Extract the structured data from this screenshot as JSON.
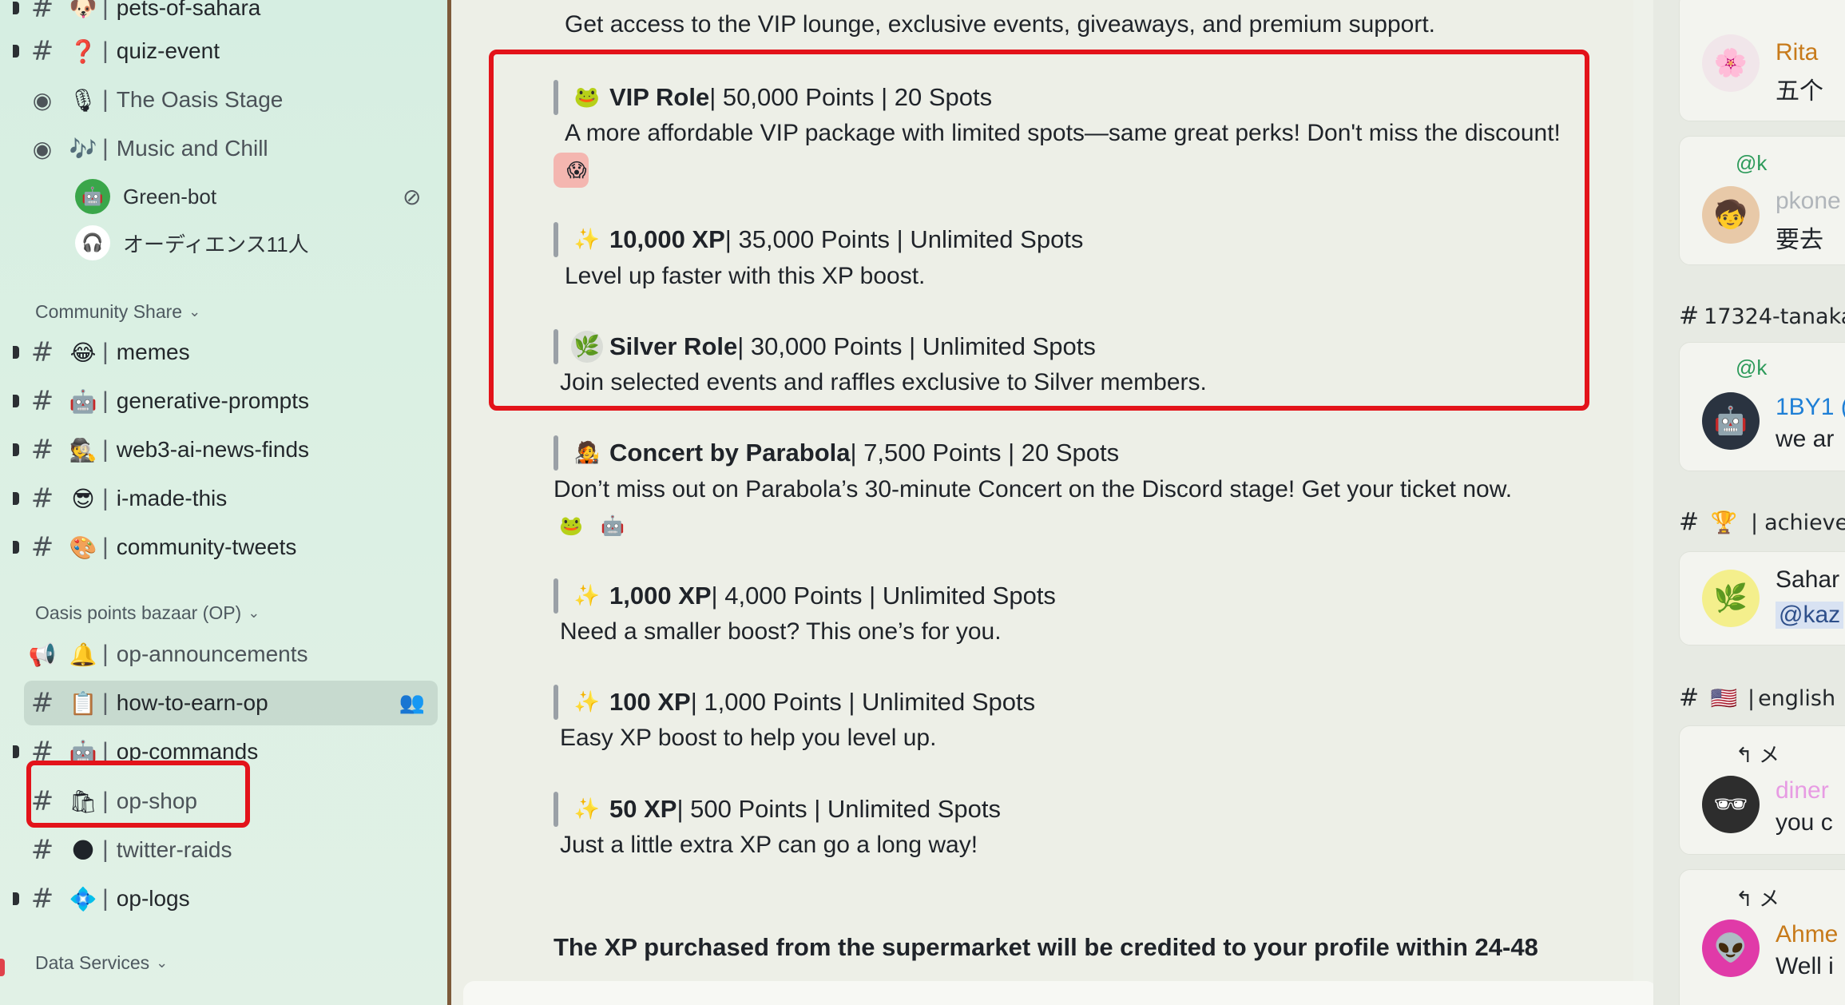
{
  "sidebar": {
    "channels": [
      {
        "icon": "#",
        "emoji": "🐶",
        "name": "pets-of-sahara",
        "unread": true
      },
      {
        "icon": "#",
        "emoji": "❓",
        "name": "quiz-event",
        "unread": true
      },
      {
        "icon": "📡",
        "emoji": "🎙",
        "name": "The Oasis Stage",
        "unread": false
      },
      {
        "icon": "📡",
        "emoji": "🎶",
        "name": "Music and Chill",
        "unread": false
      }
    ],
    "voice_users": [
      {
        "name": "Green-bot",
        "avatar": "🤖"
      },
      {
        "name": "オーディエンス11人",
        "avatar": "🎧"
      }
    ],
    "category_community": "Community Share",
    "community_channels": [
      {
        "emoji": "😂",
        "name": "memes"
      },
      {
        "emoji": "🤖",
        "name": "generative-prompts"
      },
      {
        "emoji": "🕵",
        "name": "web3-ai-news-finds"
      },
      {
        "emoji": "😎",
        "name": "i-made-this"
      },
      {
        "emoji": "🎨",
        "name": "community-tweets"
      }
    ],
    "category_bazaar": "Oasis points bazaar (OP)",
    "bazaar_channels": [
      {
        "icon": "📢",
        "emoji": "🔔",
        "name": "op-announcements"
      },
      {
        "icon": "#",
        "emoji": "📋",
        "name": "how-to-earn-op"
      },
      {
        "icon": "#",
        "emoji": "🤖",
        "name": "op-commands"
      },
      {
        "icon": "#",
        "emoji": "🛍",
        "name": "op-shop"
      },
      {
        "icon": "#",
        "emoji": "🌑",
        "name": "twitter-raids"
      },
      {
        "icon": "#",
        "emoji": "💠",
        "name": "op-logs"
      }
    ],
    "category_data": "Data Services"
  },
  "main": {
    "top_line": "Get access to the VIP lounge, exclusive events, giveaways, and premium support.",
    "items": [
      {
        "emoji": "🐸",
        "title": "VIP Role",
        "meta": " | 50,000 Points | 20 Spots",
        "desc": "A more affordable VIP package with limited spots—same great perks! Don't miss the discount!",
        "desc_emoji": "😱"
      },
      {
        "emoji": "✨",
        "title": "10,000 XP",
        "meta": " | 35,000 Points | Unlimited Spots",
        "desc": "Level up faster with this XP boost."
      },
      {
        "emoji": "🌿",
        "title": "Silver Role",
        "meta": " | 30,000 Points | Unlimited Spots",
        "desc": "Join selected events and raffles exclusive to Silver members."
      },
      {
        "emoji": "🧑‍🎤",
        "title": "Concert by Parabola",
        "meta": " | 7,500 Points | 20 Spots",
        "desc": "Don’t miss out on Parabola’s 30-minute Concert on the Discord stage! Get your ticket now."
      },
      {
        "emoji": "✨",
        "title": "1,000 XP",
        "meta": " | 4,000 Points | Unlimited Spots",
        "desc": "Need a smaller boost? This one’s for you."
      },
      {
        "emoji": "✨",
        "title": "100 XP",
        "meta": " | 1,000 Points | Unlimited Spots",
        "desc": "Easy XP boost to help you level up."
      },
      {
        "emoji": "✨",
        "title": "50 XP",
        "meta": " | 500 Points | Unlimited Spots",
        "desc": "Just a little extra XP can go a long way!"
      }
    ],
    "bottom_note": "The XP purchased from the supermarket will be credited to your profile within 24-48"
  },
  "right_panel": {
    "cards": [
      {
        "name": "Rita",
        "text": "五个",
        "avatar": "🌸",
        "name_color": "#c77a1a"
      },
      {
        "reply": "@k",
        "name": "pkone",
        "text": "要去",
        "avatar": "🧒",
        "name_color": "#9aa0a6"
      }
    ],
    "channel_1": "17324-tanaka",
    "cards2": [
      {
        "reply": "@k",
        "name": "1BY1 (",
        "text": "we ar",
        "avatar": "🤖",
        "name_color": "#1e7fd6"
      }
    ],
    "channel_2": "achiever",
    "channel_2_emoji": "🏆",
    "cards3": [
      {
        "name": "Sahar",
        "text": "@kaz",
        "avatar": "🌿",
        "name_color": "#23272b"
      }
    ],
    "channel_3": "english",
    "channel_3_emoji": "🇺🇸",
    "cards4": [
      {
        "reply": "↰ メ",
        "name": "diner",
        "text": "you c",
        "avatar": "🕶",
        "name_color": "#e79be3"
      },
      {
        "reply": "↰ メ",
        "name": "Ahme",
        "text": "Well i",
        "avatar": "👽",
        "name_color": "#c77a1a"
      }
    ]
  },
  "colors": {
    "highlight": "#e3131a",
    "sidebar_bg": "#d6eee2",
    "main_bg": "#edefe7"
  }
}
